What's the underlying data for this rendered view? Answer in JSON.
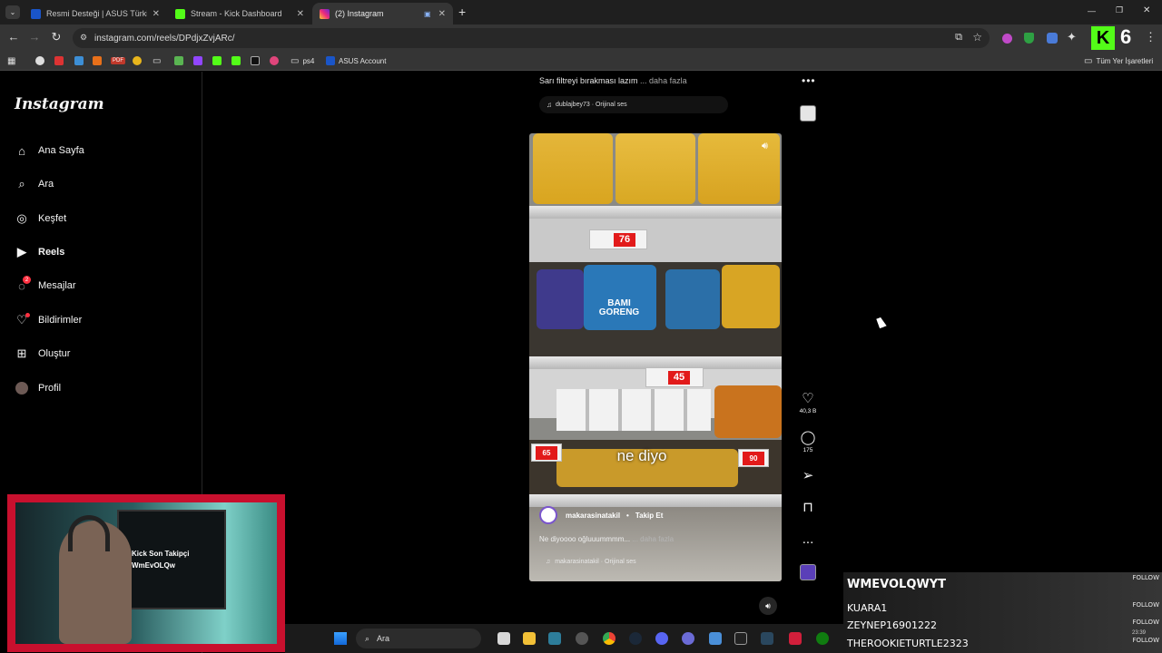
{
  "browser": {
    "tabs": [
      {
        "title": "Resmi Desteği | ASUS Türkiye",
        "icon": "asus-icon"
      },
      {
        "title": "Stream - Kick Dashboard",
        "icon": "kick-icon"
      },
      {
        "title": "(2) Instagram",
        "icon": "instagram-icon"
      }
    ],
    "new_tab": "+",
    "url": "instagram.com/reels/DPdjxZvjARc/",
    "bookmarks": {
      "folder_ps4": "ps4",
      "asus_account": "ASUS Account",
      "all_bookmarks": "Tüm Yer İşaretleri",
      "pdf": "PDF"
    },
    "window_controls": {
      "minimize": "—",
      "maximize": "❐",
      "close": "✕"
    },
    "ext_badge": "6"
  },
  "sidebar": {
    "logo": "Instagram",
    "items": [
      {
        "label": "Ana Sayfa",
        "icon": "home-icon"
      },
      {
        "label": "Ara",
        "icon": "search-icon"
      },
      {
        "label": "Keşfet",
        "icon": "compass-icon"
      },
      {
        "label": "Reels",
        "icon": "reels-icon"
      },
      {
        "label": "Mesajlar",
        "icon": "messenger-icon",
        "badge": "2"
      },
      {
        "label": "Bildirimler",
        "icon": "heart-icon"
      },
      {
        "label": "Oluştur",
        "icon": "plus-square-icon"
      },
      {
        "label": "Profil",
        "icon": "avatar-icon"
      }
    ]
  },
  "reel_top": {
    "caption": "Sarı filtreyi bırakması lazım",
    "more": "... daha fazla",
    "audio": "dublajbey73 · Orijinal ses"
  },
  "reel": {
    "prices": [
      "76",
      "45",
      "65",
      "90"
    ],
    "pack_text": "BAMI GORENG",
    "subtitle": "ne diyo",
    "author": "makarasinatakil",
    "follow": "Takip Et",
    "separator": "•",
    "caption": "Ne diyoooo oğluuummmm...",
    "more": "... daha fazla",
    "audio": "makarasinatakil · Orijinal ses"
  },
  "actions": {
    "likes": "40,3 B",
    "comments": "175",
    "more": "..."
  },
  "webcam": {
    "overlay_line1": "Kick Son Takipçi",
    "overlay_line2": "WmEvOLQw"
  },
  "chat": [
    {
      "name": "WMEVOLQWYT",
      "action": "FOLLOW"
    },
    {
      "name": "KUARA1",
      "action": "FOLLOW"
    },
    {
      "name": "ZEYNEP16901222",
      "action": "FOLLOW"
    },
    {
      "name": "THEROOKIETURTLE2323",
      "action": "FOLLOW"
    }
  ],
  "taskbar": {
    "search": "Ara"
  },
  "tray": {
    "time": "23:39"
  },
  "colors": {
    "accent_red": "#c8102e",
    "price_red": "#e21a1a",
    "kick_green": "#53fc18",
    "badge_red": "#ff3040"
  }
}
